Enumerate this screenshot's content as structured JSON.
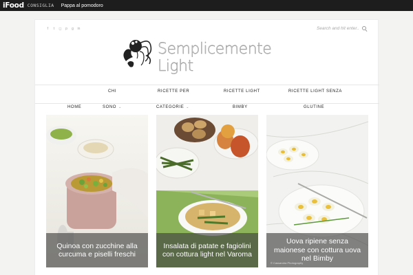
{
  "topbar": {
    "brand": "iFood",
    "brand_tag": "CONSIGLIA",
    "promo_link": "Pappa al pomodoro"
  },
  "header": {
    "social_icons": [
      "facebook-icon",
      "twitter-icon",
      "instagram-icon",
      "pinterest-icon",
      "google-plus-icon",
      "linkedin-icon"
    ],
    "search_placeholder": "Search and hit enter...",
    "logo_text": "Semplicemente Light"
  },
  "nav": {
    "row1": [
      "CHI",
      "RICETTE PER",
      "RICETTE LIGHT",
      "RICETTE LIGHT SENZA"
    ],
    "row2": [
      "HOME",
      "SONO",
      "CATEGORIE",
      "BIMBY",
      "GLUTINE"
    ]
  },
  "posts": [
    {
      "title": "Quinoa con zucchine alla curcuma e piselli freschi"
    },
    {
      "title": "Insalata di patate e fagiolini con cottura light nel Varoma"
    },
    {
      "title": "Uova ripiene senza maionese con cottura uova nel Bimby"
    }
  ],
  "credit": "© Cassandra Photography",
  "colors": {
    "topbar": "#1d1d1d",
    "page_bg": "#f3f3f1",
    "caption_overlay": "#3c3c3c"
  }
}
